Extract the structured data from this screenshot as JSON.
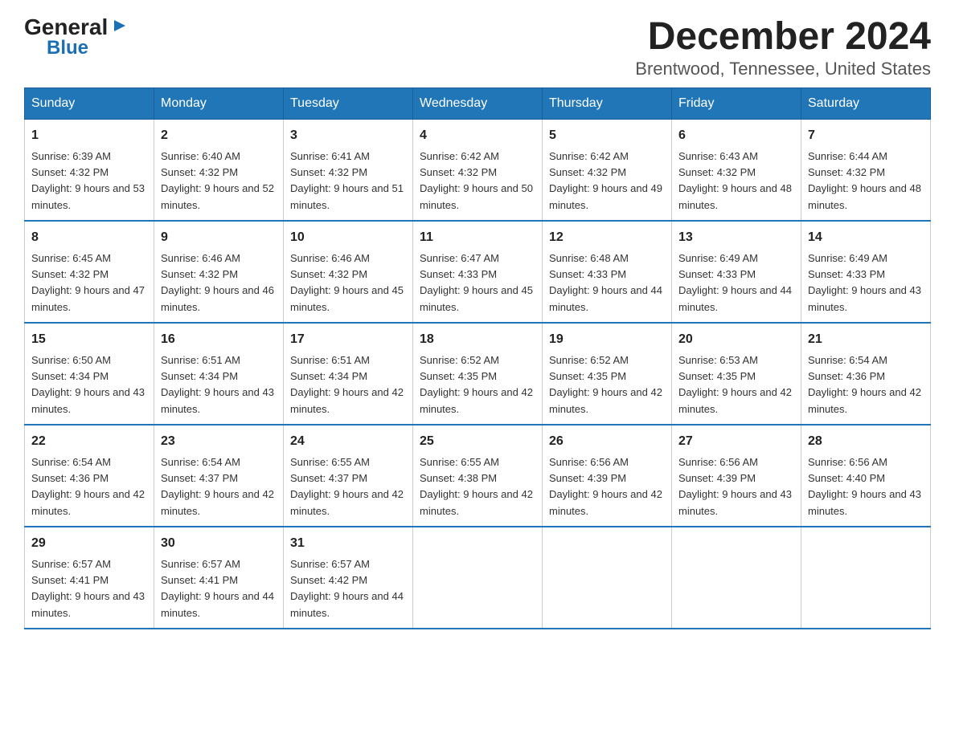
{
  "logo": {
    "general": "General",
    "triangle": "▶",
    "blue": "Blue"
  },
  "title": "December 2024",
  "subtitle": "Brentwood, Tennessee, United States",
  "days_of_week": [
    "Sunday",
    "Monday",
    "Tuesday",
    "Wednesday",
    "Thursday",
    "Friday",
    "Saturday"
  ],
  "weeks": [
    [
      {
        "day": "1",
        "sunrise": "6:39 AM",
        "sunset": "4:32 PM",
        "daylight": "9 hours and 53 minutes."
      },
      {
        "day": "2",
        "sunrise": "6:40 AM",
        "sunset": "4:32 PM",
        "daylight": "9 hours and 52 minutes."
      },
      {
        "day": "3",
        "sunrise": "6:41 AM",
        "sunset": "4:32 PM",
        "daylight": "9 hours and 51 minutes."
      },
      {
        "day": "4",
        "sunrise": "6:42 AM",
        "sunset": "4:32 PM",
        "daylight": "9 hours and 50 minutes."
      },
      {
        "day": "5",
        "sunrise": "6:42 AM",
        "sunset": "4:32 PM",
        "daylight": "9 hours and 49 minutes."
      },
      {
        "day": "6",
        "sunrise": "6:43 AM",
        "sunset": "4:32 PM",
        "daylight": "9 hours and 48 minutes."
      },
      {
        "day": "7",
        "sunrise": "6:44 AM",
        "sunset": "4:32 PM",
        "daylight": "9 hours and 48 minutes."
      }
    ],
    [
      {
        "day": "8",
        "sunrise": "6:45 AM",
        "sunset": "4:32 PM",
        "daylight": "9 hours and 47 minutes."
      },
      {
        "day": "9",
        "sunrise": "6:46 AM",
        "sunset": "4:32 PM",
        "daylight": "9 hours and 46 minutes."
      },
      {
        "day": "10",
        "sunrise": "6:46 AM",
        "sunset": "4:32 PM",
        "daylight": "9 hours and 45 minutes."
      },
      {
        "day": "11",
        "sunrise": "6:47 AM",
        "sunset": "4:33 PM",
        "daylight": "9 hours and 45 minutes."
      },
      {
        "day": "12",
        "sunrise": "6:48 AM",
        "sunset": "4:33 PM",
        "daylight": "9 hours and 44 minutes."
      },
      {
        "day": "13",
        "sunrise": "6:49 AM",
        "sunset": "4:33 PM",
        "daylight": "9 hours and 44 minutes."
      },
      {
        "day": "14",
        "sunrise": "6:49 AM",
        "sunset": "4:33 PM",
        "daylight": "9 hours and 43 minutes."
      }
    ],
    [
      {
        "day": "15",
        "sunrise": "6:50 AM",
        "sunset": "4:34 PM",
        "daylight": "9 hours and 43 minutes."
      },
      {
        "day": "16",
        "sunrise": "6:51 AM",
        "sunset": "4:34 PM",
        "daylight": "9 hours and 43 minutes."
      },
      {
        "day": "17",
        "sunrise": "6:51 AM",
        "sunset": "4:34 PM",
        "daylight": "9 hours and 42 minutes."
      },
      {
        "day": "18",
        "sunrise": "6:52 AM",
        "sunset": "4:35 PM",
        "daylight": "9 hours and 42 minutes."
      },
      {
        "day": "19",
        "sunrise": "6:52 AM",
        "sunset": "4:35 PM",
        "daylight": "9 hours and 42 minutes."
      },
      {
        "day": "20",
        "sunrise": "6:53 AM",
        "sunset": "4:35 PM",
        "daylight": "9 hours and 42 minutes."
      },
      {
        "day": "21",
        "sunrise": "6:54 AM",
        "sunset": "4:36 PM",
        "daylight": "9 hours and 42 minutes."
      }
    ],
    [
      {
        "day": "22",
        "sunrise": "6:54 AM",
        "sunset": "4:36 PM",
        "daylight": "9 hours and 42 minutes."
      },
      {
        "day": "23",
        "sunrise": "6:54 AM",
        "sunset": "4:37 PM",
        "daylight": "9 hours and 42 minutes."
      },
      {
        "day": "24",
        "sunrise": "6:55 AM",
        "sunset": "4:37 PM",
        "daylight": "9 hours and 42 minutes."
      },
      {
        "day": "25",
        "sunrise": "6:55 AM",
        "sunset": "4:38 PM",
        "daylight": "9 hours and 42 minutes."
      },
      {
        "day": "26",
        "sunrise": "6:56 AM",
        "sunset": "4:39 PM",
        "daylight": "9 hours and 42 minutes."
      },
      {
        "day": "27",
        "sunrise": "6:56 AM",
        "sunset": "4:39 PM",
        "daylight": "9 hours and 43 minutes."
      },
      {
        "day": "28",
        "sunrise": "6:56 AM",
        "sunset": "4:40 PM",
        "daylight": "9 hours and 43 minutes."
      }
    ],
    [
      {
        "day": "29",
        "sunrise": "6:57 AM",
        "sunset": "4:41 PM",
        "daylight": "9 hours and 43 minutes."
      },
      {
        "day": "30",
        "sunrise": "6:57 AM",
        "sunset": "4:41 PM",
        "daylight": "9 hours and 44 minutes."
      },
      {
        "day": "31",
        "sunrise": "6:57 AM",
        "sunset": "4:42 PM",
        "daylight": "9 hours and 44 minutes."
      },
      null,
      null,
      null,
      null
    ]
  ]
}
